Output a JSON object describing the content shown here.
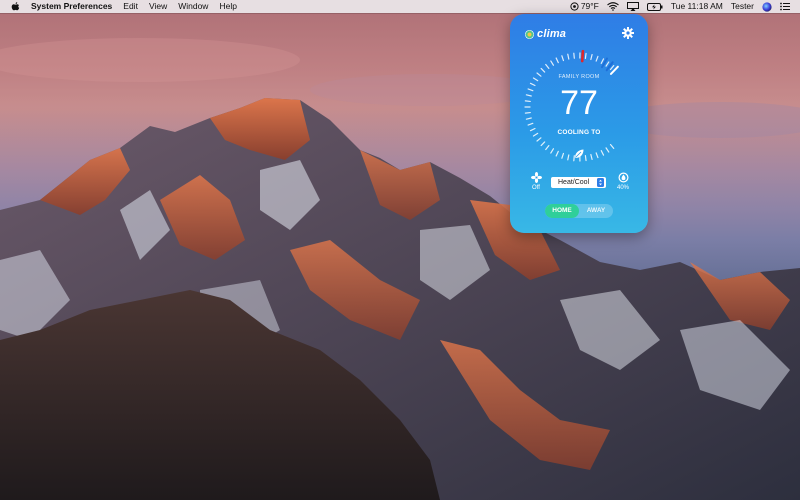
{
  "menubar": {
    "apple_icon": "apple-logo-icon",
    "app_name": "System Preferences",
    "menus": [
      "Edit",
      "View",
      "Window",
      "Help"
    ],
    "weather": "79°F",
    "clock": "Tue 11:18 AM",
    "user": "Tester"
  },
  "widget": {
    "brand": "clima",
    "room": "FAMILY ROOM",
    "temperature": "77",
    "mode_status": "COOLING TO",
    "fan_label": "Off",
    "mode_select": "Heat/Cool",
    "humidity": "40%",
    "home_label": "HOME",
    "away_label": "AWAY",
    "colors": {
      "gradient_top": "#2f7de6",
      "gradient_bottom": "#38b8e6",
      "home_active": "#2fcf9a",
      "setpoint_marker": "#e0262b"
    }
  }
}
